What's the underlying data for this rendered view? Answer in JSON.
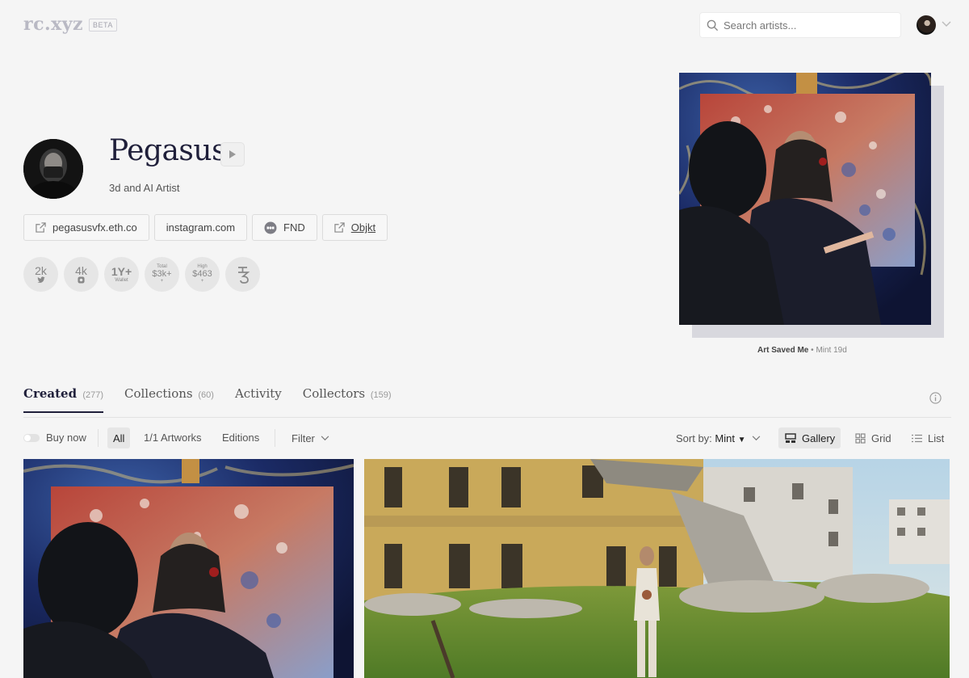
{
  "header": {
    "logo": "rc.xyz",
    "badge": "BETA",
    "search_placeholder": "Search artists..."
  },
  "profile": {
    "name": "Pegasus",
    "bio": "3d and AI Artist",
    "links": [
      {
        "label": "pegasusvfx.eth.co",
        "icon": "external-link-icon"
      },
      {
        "label": "instagram.com",
        "icon": ""
      },
      {
        "label": "FND",
        "icon": "foundation-icon"
      },
      {
        "label": "Objkt",
        "icon": "external-link-icon"
      }
    ],
    "stats": {
      "twitter": "2k",
      "instagram": "4k",
      "wallet_age": "1Y+",
      "wallet_label": "Wallet",
      "total_label": "Total",
      "total": "$3k+",
      "total_plus": "+",
      "high_label": "High",
      "high": "$463",
      "high_plus": "+"
    }
  },
  "featured": {
    "title": "Art Saved Me",
    "separator": "•",
    "meta": "Mint 19d"
  },
  "tabs": [
    {
      "label": "Created",
      "count": "(277)",
      "active": true
    },
    {
      "label": "Collections",
      "count": "(60)",
      "active": false
    },
    {
      "label": "Activity",
      "count": "",
      "active": false
    },
    {
      "label": "Collectors",
      "count": "(159)",
      "active": false
    }
  ],
  "filters": {
    "buy_now": "Buy now",
    "all": "All",
    "one_of_one": "1/1 Artworks",
    "editions": "Editions",
    "filter": "Filter",
    "sort_prefix": "Sort by:",
    "sort_value": "Mint",
    "sort_arrow": "▼",
    "views": [
      "Gallery",
      "Grid",
      "List"
    ]
  },
  "colors": {
    "accent": "#1f1f3a",
    "background": "#f5f5f5"
  }
}
